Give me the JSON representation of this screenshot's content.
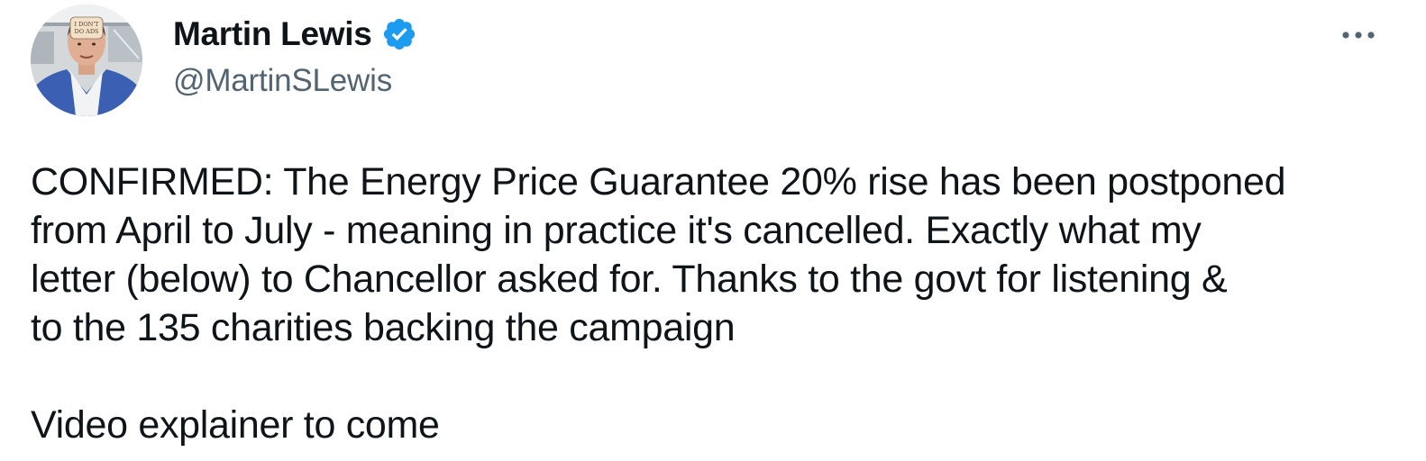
{
  "author": {
    "display_name": "Martin Lewis",
    "handle": "@MartinSLewis",
    "verified": true,
    "verified_color": "#1d9bf0",
    "avatar_sticker_text": "I DON'T DO ADS",
    "avatar_icon": "profile-photo"
  },
  "more_icon": "more-options-icon",
  "tweet": {
    "lines": [
      "CONFIRMED: The Energy Price Guarantee 20% rise has been postponed",
      "from April to July - meaning in practice it's cancelled. Exactly what my",
      "letter (below) to Chancellor asked for. Thanks to the govt for listening &",
      "to the 135 charities backing the campaign"
    ],
    "footer": "Video explainer to come"
  },
  "colors": {
    "text": "#0f1419",
    "secondary": "#536471"
  }
}
